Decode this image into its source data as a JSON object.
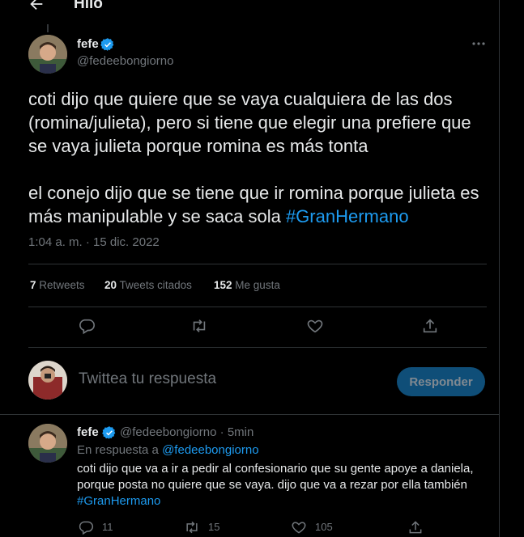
{
  "header": {
    "title": "Hilo"
  },
  "main_tweet": {
    "author_name": "fefe",
    "author_handle": "@fedeebongiorno",
    "paragraph_1": "coti dijo que quiere que se vaya cualquiera de las dos (romina/julieta), pero si tiene que elegir una prefiere que se vaya julieta porque romina es más tonta",
    "paragraph_2_text": "el conejo dijo que se tiene que ir romina porque julieta es más manipulable y se saca sola ",
    "paragraph_2_hashtag": "#GranHermano",
    "timestamp": "1:04 a. m. · 15 dic. 2022",
    "retweets_count": "7",
    "retweets_label": "Retweets",
    "quotes_count": "20",
    "quotes_label": "Tweets citados",
    "likes_count": "152",
    "likes_label": "Me gusta"
  },
  "composer": {
    "placeholder": "Twittea tu respuesta",
    "button_label": "Responder"
  },
  "reply_tweet": {
    "author_name": "fefe",
    "author_handle": "@fedeebongiorno · 5min",
    "in_reply_prefix": "En respuesta a ",
    "in_reply_handle": "@fedeebongiorno",
    "text_line_1": "coti dijo que va a ir a pedir al confesionario que su gente apoye a daniela,",
    "text_line_2": "porque posta no quiere que se vaya. dijo que va a rezar por ella también",
    "hashtag": "#GranHermano",
    "replies_count": "11",
    "retweets_count": "15",
    "likes_count": "105"
  },
  "colors": {
    "background": "#000000",
    "text": "#e7e9ea",
    "muted": "#71767b",
    "link": "#1d9bf0",
    "divider": "#2f3336"
  }
}
